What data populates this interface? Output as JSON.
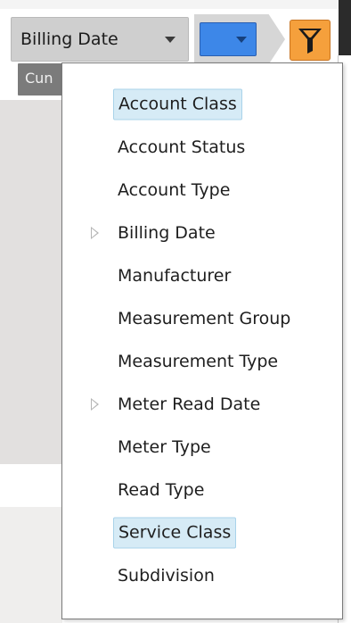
{
  "toolbar": {
    "billing_select_label": "Billing Date",
    "tab_label": "Cun",
    "swatch_color": "#3d87e8",
    "filter_button_color": "#f5a03c",
    "filter_icon": "filter-funnel-icon"
  },
  "menu": {
    "items": [
      {
        "label": "Account Class",
        "selected": true,
        "has_submenu": false
      },
      {
        "label": "Account Status",
        "selected": false,
        "has_submenu": false
      },
      {
        "label": "Account Type",
        "selected": false,
        "has_submenu": false
      },
      {
        "label": "Billing Date",
        "selected": false,
        "has_submenu": true
      },
      {
        "label": "Manufacturer",
        "selected": false,
        "has_submenu": false
      },
      {
        "label": "Measurement Group",
        "selected": false,
        "has_submenu": false
      },
      {
        "label": "Measurement Type",
        "selected": false,
        "has_submenu": false
      },
      {
        "label": "Meter Read Date",
        "selected": false,
        "has_submenu": true
      },
      {
        "label": "Meter Type",
        "selected": false,
        "has_submenu": false
      },
      {
        "label": "Read Type",
        "selected": false,
        "has_submenu": false
      },
      {
        "label": "Service Class",
        "selected": true,
        "has_submenu": false
      },
      {
        "label": "Subdivision",
        "selected": false,
        "has_submenu": false
      }
    ]
  }
}
